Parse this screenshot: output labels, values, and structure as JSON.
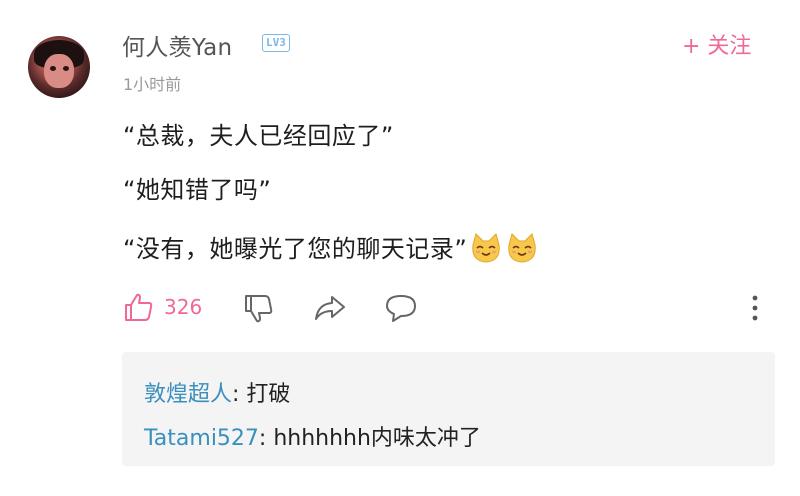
{
  "comment": {
    "username": "何人羡Yan",
    "level": "LV3",
    "follow_label": "+ 关注",
    "time": "1小时前",
    "lines": [
      "“总裁，夫人已经回应了”",
      "“她知错了吗”",
      "“没有，她曝光了您的聊天记录”"
    ],
    "emojis": [
      "cat-smile-emoji",
      "cat-smile-emoji"
    ],
    "like_count": "326",
    "colors": {
      "accent": "#f0689a",
      "reply_name": "#3a8fbd",
      "level": "#7bb8e6"
    }
  },
  "replies": [
    {
      "name": "敦煌超人",
      "sep": ": ",
      "text": "打破"
    },
    {
      "name": "Tatami527",
      "sep": ": ",
      "text": "hhhhhhh内味太冲了"
    }
  ]
}
